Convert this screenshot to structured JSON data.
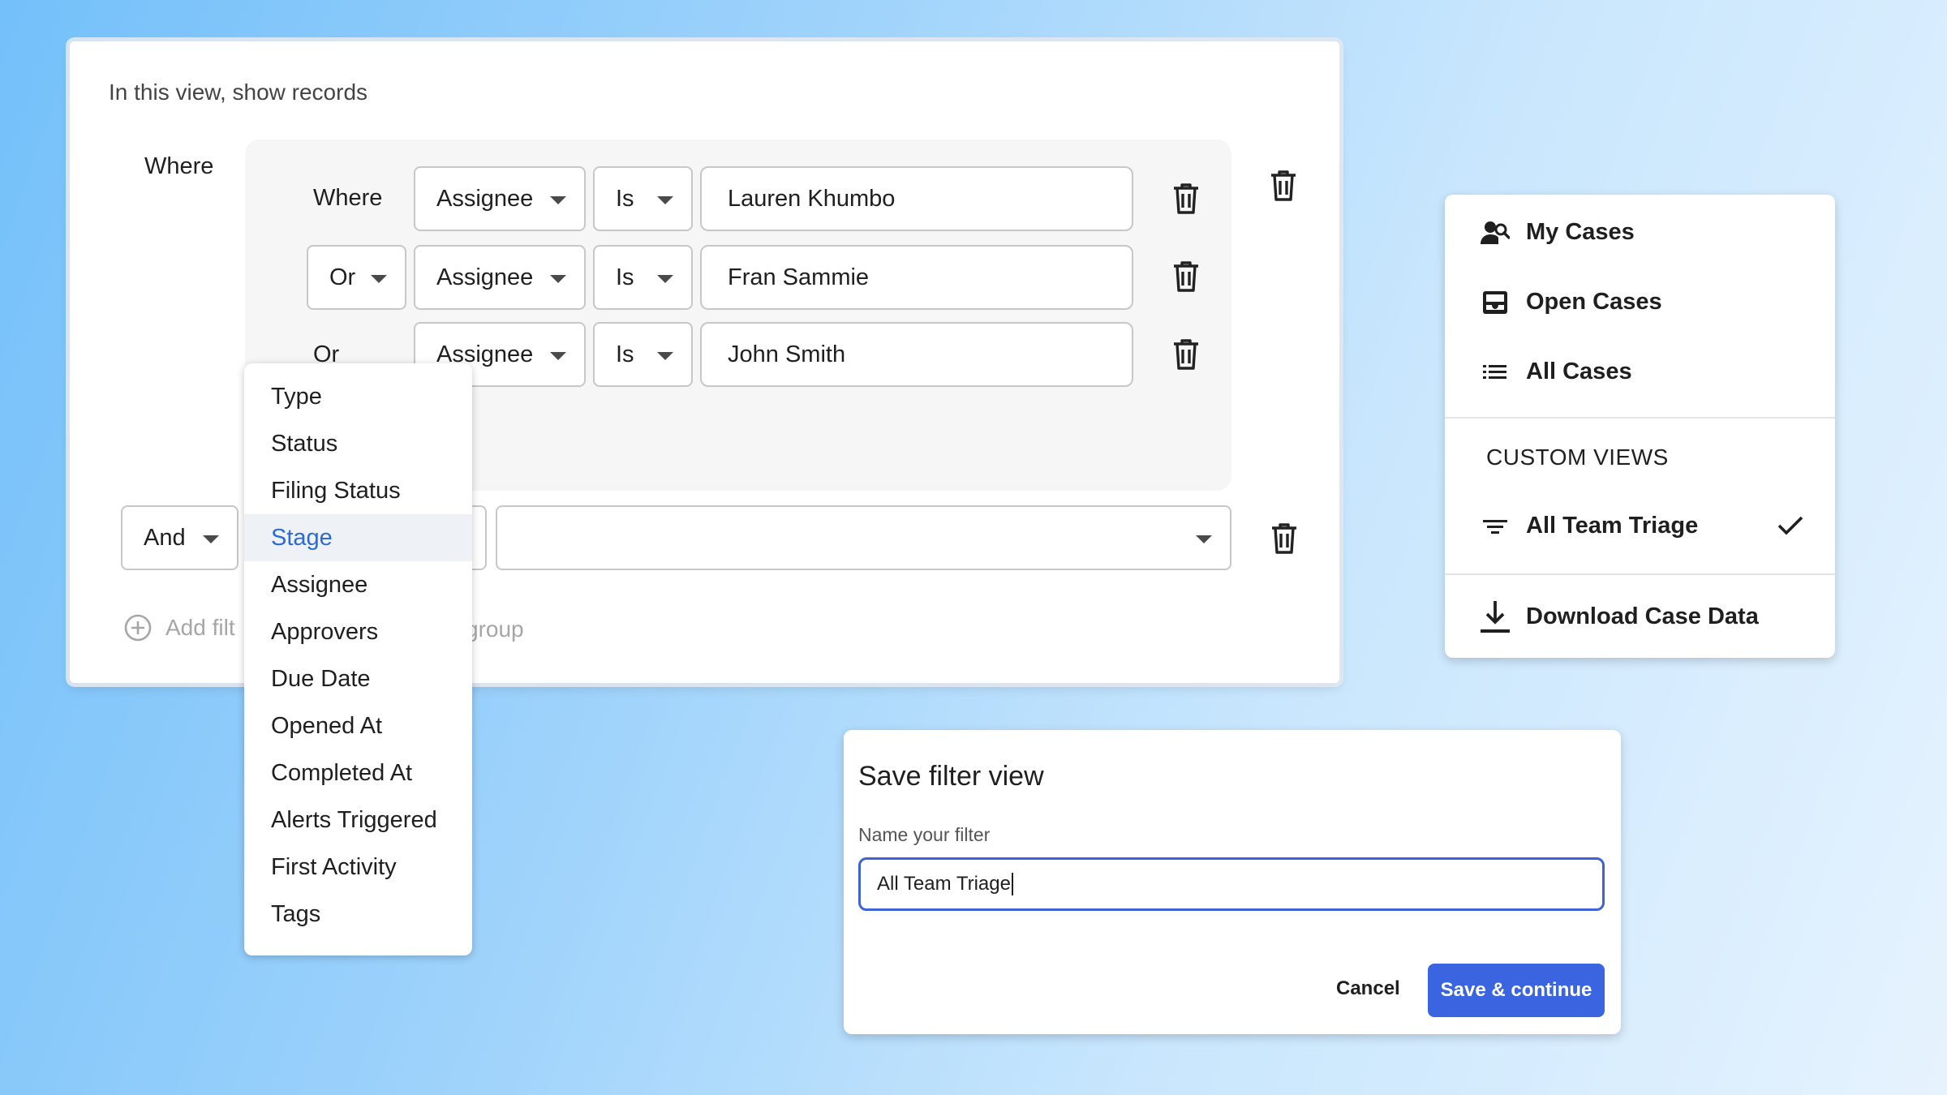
{
  "filter": {
    "heading": "In this view, show records",
    "where_label": "Where",
    "rows": [
      {
        "connector": "Where",
        "field": "Assignee",
        "operator": "Is",
        "value": "Lauren Khumbo"
      },
      {
        "connector": "Or",
        "field": "Assignee",
        "operator": "Is",
        "value": "Fran Sammie"
      },
      {
        "connector": "Or",
        "field": "Assignee",
        "operator": "Is",
        "value": "John Smith"
      }
    ],
    "and_connector": "And",
    "and_value": "",
    "add_filter_label": "Add filt",
    "add_group_fragment": "group"
  },
  "field_dropdown": {
    "options": [
      "Type",
      "Status",
      "Filing Status",
      "Stage",
      "Assignee",
      "Approvers",
      "Due Date",
      "Opened At",
      "Completed At",
      "Alerts Triggered",
      "First Activity",
      "Tags"
    ],
    "selected": "Stage"
  },
  "view_menu": {
    "items": [
      {
        "label": "My Cases",
        "icon": "person-search-icon"
      },
      {
        "label": "Open Cases",
        "icon": "inbox-icon"
      },
      {
        "label": "All Cases",
        "icon": "list-icon"
      }
    ],
    "section_title": "CUSTOM VIEWS",
    "custom_views": [
      {
        "label": "All Team Triage",
        "icon": "filter-icon",
        "checked": true
      }
    ],
    "download_label": "Download Case Data"
  },
  "save_dialog": {
    "title": "Save filter view",
    "field_label": "Name your filter",
    "input_value": "All Team Triage",
    "cancel_label": "Cancel",
    "save_label": "Save & continue"
  },
  "colors": {
    "accent": "#3a64e0",
    "selected_text": "#2c6bd4",
    "focus_border": "#3f63d6"
  }
}
